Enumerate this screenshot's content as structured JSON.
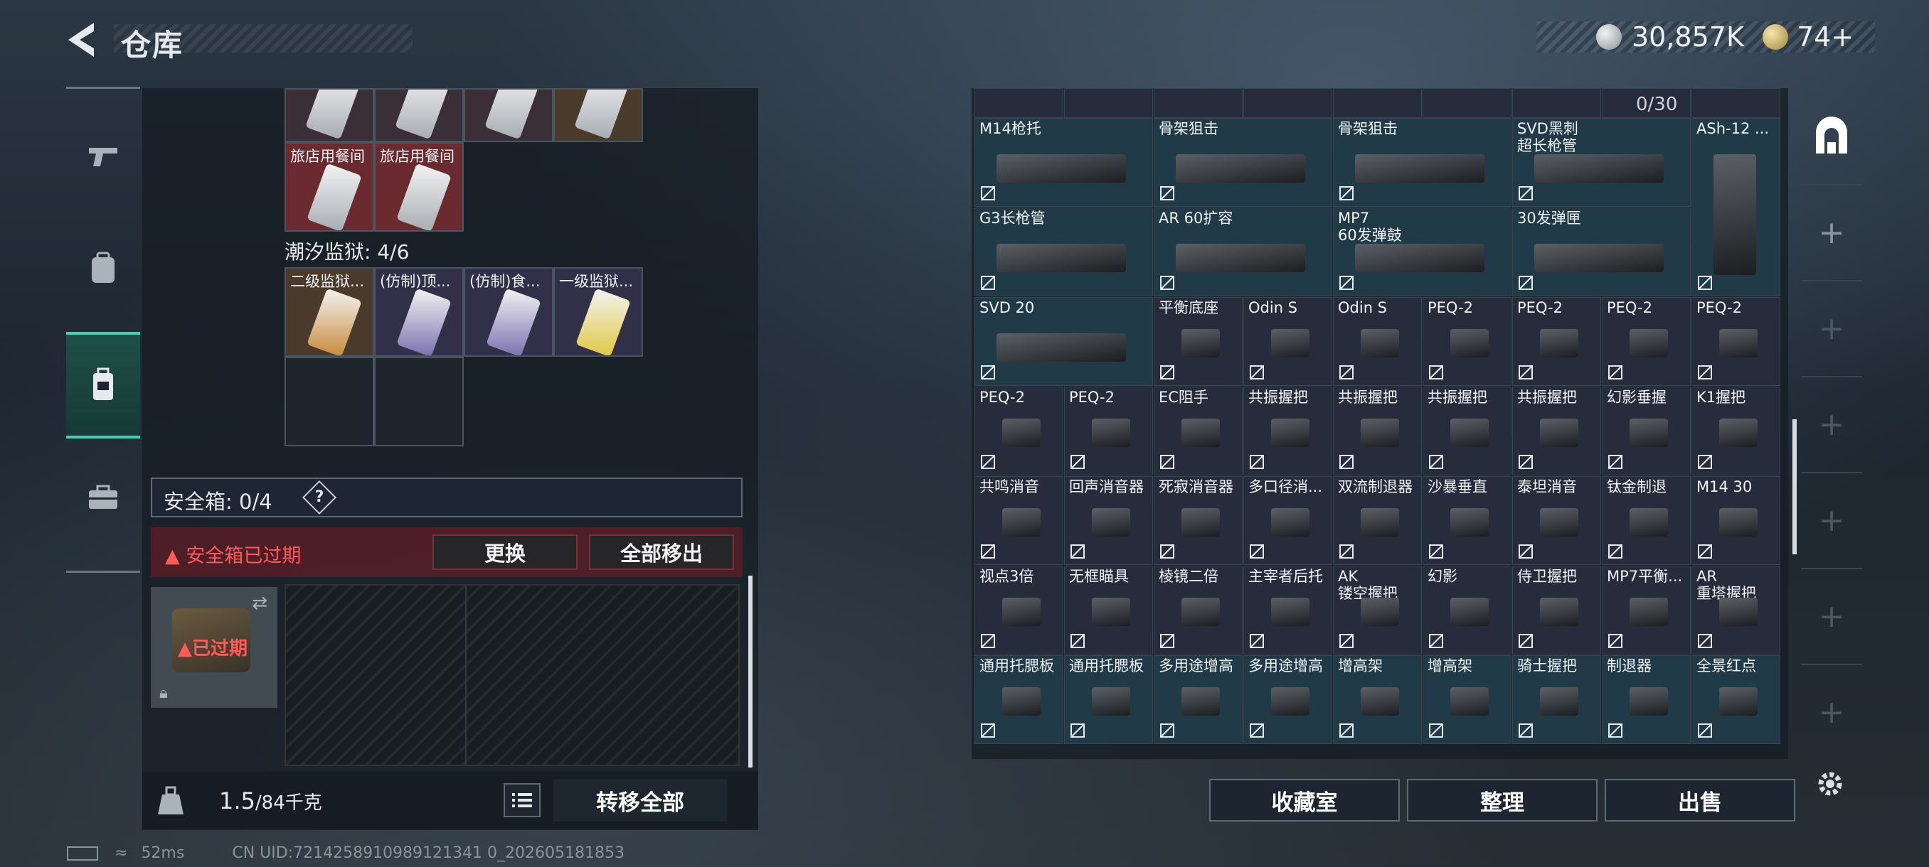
{
  "header": {
    "title": "仓库",
    "silver": "30,857K",
    "gold": "74+"
  },
  "stash": {
    "top_row": [
      {
        "label": ""
      },
      {
        "label": ""
      },
      {
        "label": ""
      },
      {
        "label": ""
      }
    ],
    "row2": [
      {
        "label": "旅店用餐间"
      },
      {
        "label": "旅店用餐间"
      }
    ],
    "section_label": "潮汐监狱: 4/6",
    "section_items": [
      {
        "label": "二级监狱..."
      },
      {
        "label": "(仿制)顶..."
      },
      {
        "label": "(仿制)食..."
      },
      {
        "label": "一级监狱..."
      }
    ],
    "safe_label": "安全箱: 0/4",
    "help_symbol": "?",
    "expired_text": "安全箱已过期",
    "replace_btn": "更换",
    "move_all_btn": "全部移出",
    "expired_stamp": "已过期",
    "weight_value": "1.5",
    "weight_capacity": "/84千克",
    "transfer_btn": "转移全部"
  },
  "inventory": {
    "count": "0/30",
    "items": [
      {
        "name": "M14枪托",
        "col": 0,
        "row": 0,
        "w": 2,
        "teal": true
      },
      {
        "name": "骨架狙击",
        "col": 2,
        "row": 0,
        "w": 2,
        "teal": true
      },
      {
        "name": "骨架狙击",
        "col": 4,
        "row": 0,
        "w": 2,
        "teal": true
      },
      {
        "name": "SVD黑刺\n超长枪管",
        "col": 6,
        "row": 0,
        "w": 2,
        "teal": true
      },
      {
        "name": "ASh-12 ...",
        "col": 8,
        "row": 0,
        "w": 1,
        "h": 2,
        "teal": true
      },
      {
        "name": "G3长枪管",
        "col": 0,
        "row": 1,
        "w": 2,
        "teal": true
      },
      {
        "name": "AR 60扩容",
        "col": 2,
        "row": 1,
        "w": 2,
        "teal": true
      },
      {
        "name": "MP7\n60发弹鼓",
        "col": 4,
        "row": 1,
        "w": 2,
        "teal": true
      },
      {
        "name": "30发弹匣",
        "col": 6,
        "row": 1,
        "w": 2,
        "teal": true
      },
      {
        "name": "SVD 20",
        "col": 0,
        "row": 2,
        "w": 2,
        "teal": true
      },
      {
        "name": "平衡底座",
        "col": 2,
        "row": 2,
        "w": 1
      },
      {
        "name": "Odin S",
        "col": 3,
        "row": 2,
        "w": 1
      },
      {
        "name": "Odin S",
        "col": 4,
        "row": 2,
        "w": 1
      },
      {
        "name": "PEQ-2",
        "col": 5,
        "row": 2,
        "w": 1
      },
      {
        "name": "PEQ-2",
        "col": 6,
        "row": 2,
        "w": 1
      },
      {
        "name": "PEQ-2",
        "col": 7,
        "row": 2,
        "w": 1
      },
      {
        "name": "PEQ-2",
        "col": 8,
        "row": 2,
        "w": 1
      },
      {
        "name": "PEQ-2",
        "col": 0,
        "row": 3,
        "w": 1
      },
      {
        "name": "PEQ-2",
        "col": 1,
        "row": 3,
        "w": 1
      },
      {
        "name": "EC阻手",
        "col": 2,
        "row": 3,
        "w": 1
      },
      {
        "name": "共振握把",
        "col": 3,
        "row": 3,
        "w": 1
      },
      {
        "name": "共振握把",
        "col": 4,
        "row": 3,
        "w": 1
      },
      {
        "name": "共振握把",
        "col": 5,
        "row": 3,
        "w": 1
      },
      {
        "name": "共振握把",
        "col": 6,
        "row": 3,
        "w": 1
      },
      {
        "name": "幻影垂握",
        "col": 7,
        "row": 3,
        "w": 1
      },
      {
        "name": "K1握把",
        "col": 8,
        "row": 3,
        "w": 1
      },
      {
        "name": "共鸣消音",
        "col": 0,
        "row": 4,
        "w": 1
      },
      {
        "name": "回声消音器",
        "col": 1,
        "row": 4,
        "w": 1
      },
      {
        "name": "死寂消音器",
        "col": 2,
        "row": 4,
        "w": 1
      },
      {
        "name": "多口径消...",
        "col": 3,
        "row": 4,
        "w": 1
      },
      {
        "name": "双流制退器",
        "col": 4,
        "row": 4,
        "w": 1
      },
      {
        "name": "沙暴垂直",
        "col": 5,
        "row": 4,
        "w": 1
      },
      {
        "name": "泰坦消音",
        "col": 6,
        "row": 4,
        "w": 1
      },
      {
        "name": "钛金制退",
        "col": 7,
        "row": 4,
        "w": 1
      },
      {
        "name": "M14 30",
        "col": 8,
        "row": 4,
        "w": 1
      },
      {
        "name": "视点3倍",
        "col": 0,
        "row": 5,
        "w": 1
      },
      {
        "name": "无框瞄具",
        "col": 1,
        "row": 5,
        "w": 1
      },
      {
        "name": "棱镜二倍",
        "col": 2,
        "row": 5,
        "w": 1
      },
      {
        "name": "主宰者后托",
        "col": 3,
        "row": 5,
        "w": 1
      },
      {
        "name": "AK\n镂空握把",
        "col": 4,
        "row": 5,
        "w": 1
      },
      {
        "name": "幻影",
        "col": 5,
        "row": 5,
        "w": 1
      },
      {
        "name": "侍卫握把",
        "col": 6,
        "row": 5,
        "w": 1
      },
      {
        "name": "MP7平衡...",
        "col": 7,
        "row": 5,
        "w": 1
      },
      {
        "name": "AR\n重塔握把",
        "col": 8,
        "row": 5,
        "w": 1
      },
      {
        "name": "通用托腮板",
        "col": 0,
        "row": 6,
        "w": 1,
        "teal": true
      },
      {
        "name": "通用托腮板",
        "col": 1,
        "row": 6,
        "w": 1,
        "teal": true
      },
      {
        "name": "多用途增高",
        "col": 2,
        "row": 6,
        "w": 1,
        "teal": true
      },
      {
        "name": "多用途增高",
        "col": 3,
        "row": 6,
        "w": 1,
        "teal": true
      },
      {
        "name": "增高架",
        "col": 4,
        "row": 6,
        "w": 1,
        "teal": true
      },
      {
        "name": "增高架",
        "col": 5,
        "row": 6,
        "w": 1,
        "teal": true
      },
      {
        "name": "骑士握把",
        "col": 6,
        "row": 6,
        "w": 1,
        "teal": true
      },
      {
        "name": "制退器",
        "col": 7,
        "row": 6,
        "w": 1,
        "teal": true
      },
      {
        "name": "全景红点",
        "col": 8,
        "row": 6,
        "w": 1,
        "teal": true
      }
    ],
    "buttons": {
      "collection": "收藏室",
      "sort": "整理",
      "sell": "出售"
    }
  },
  "rail": {
    "plus": "+"
  },
  "status": {
    "ping": "52ms",
    "uid": "CN UID:7214258910989121341 0_202605181853"
  },
  "colors": {
    "accent": "#3fd1b1",
    "danger": "#ff5a5a"
  }
}
